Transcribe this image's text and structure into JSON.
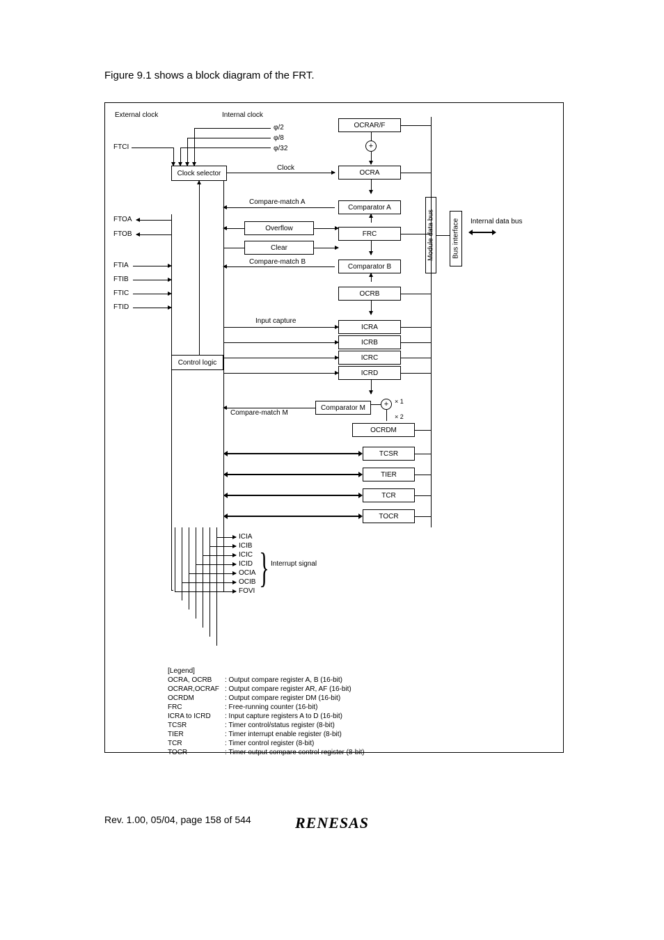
{
  "intro": "Figure 9.1 shows a block diagram of the FRT.",
  "header": {
    "external_clock": "External clock",
    "internal_clock": "Internal clock",
    "phi2": "φ/2",
    "phi8": "φ/8",
    "phi32": "φ/32"
  },
  "pins": {
    "ftci": "FTCI",
    "ftoa": "FTOA",
    "ftob": "FTOB",
    "ftia": "FTIA",
    "ftib": "FTIB",
    "ftic": "FTIC",
    "ftid": "FTID"
  },
  "blocks": {
    "clock_selector": "Clock selector",
    "clock": "Clock",
    "control_logic": "Control logic",
    "compare_match_a": "Compare-match A",
    "overflow": "Overflow",
    "clear": "Clear",
    "compare_match_b": "Compare-match B",
    "input_capture": "Input capture",
    "compare_match_m": "Compare-match M",
    "comparator_a": "Comparator A",
    "comparator_b": "Comparator B",
    "comparator_m": "Comparator M",
    "ocrar_f": "OCRAR/F",
    "ocra": "OCRA",
    "frc": "FRC",
    "ocrb": "OCRB",
    "icra": "ICRA",
    "icrb": "ICRB",
    "icrc": "ICRC",
    "icrd": "ICRD",
    "ocrdm": "OCRDM",
    "tcsr": "TCSR",
    "tier": "TIER",
    "tcr": "TCR",
    "tocr": "TOCR",
    "module_bus": "Module data bus",
    "bus_interface": "Bus interface",
    "internal_bus": "Internal data bus",
    "x1": "× 1",
    "x2": "× 2"
  },
  "interrupts": {
    "icia": "ICIA",
    "icib": "ICIB",
    "icic": "ICIC",
    "icid": "ICID",
    "ocia": "OCIA",
    "ocib": "OCIB",
    "fovi": "FOVI",
    "label": "Interrupt signal"
  },
  "legend": {
    "title": "[Legend]",
    "rows": [
      {
        "k": "OCRA, OCRB",
        "v": ": Output compare register A, B (16-bit)"
      },
      {
        "k": "OCRAR,OCRAF",
        "v": ": Output compare register AR, AF (16-bit)"
      },
      {
        "k": "OCRDM",
        "v": ": Output compare register DM (16-bit)"
      },
      {
        "k": "FRC",
        "v": ": Free-running counter (16-bit)"
      },
      {
        "k": "ICRA to ICRD",
        "v": ": Input capture registers A to D (16-bit)"
      },
      {
        "k": "TCSR",
        "v": ": Timer control/status register (8-bit)"
      },
      {
        "k": "TIER",
        "v": ": Timer interrupt enable register (8-bit)"
      },
      {
        "k": "TCR",
        "v": ": Timer control register (8-bit)"
      },
      {
        "k": "TOCR",
        "v": ": Timer output compare control register (8-bit)"
      }
    ]
  },
  "footer": "Rev. 1.00, 05/04, page 158 of 544",
  "logo": "RENESAS"
}
